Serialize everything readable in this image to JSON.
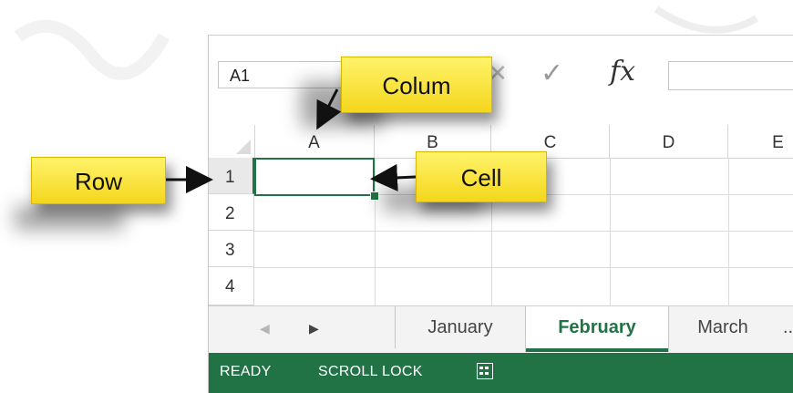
{
  "name_box": {
    "value": "A1"
  },
  "formula_bar": {
    "cancel_icon": "x-icon",
    "enter_icon": "check-icon",
    "fx_label": "fx"
  },
  "columns": [
    "A",
    "B",
    "C",
    "D",
    "E"
  ],
  "rows": [
    "1",
    "2",
    "3",
    "4"
  ],
  "sheet_tabs": {
    "tabs": [
      {
        "label": "January",
        "active": false
      },
      {
        "label": "February",
        "active": true
      },
      {
        "label": "March",
        "active": false
      }
    ],
    "more": "..."
  },
  "status_bar": {
    "ready": "READY",
    "scroll_lock": "SCROLL LOCK",
    "mode_icon": "calculator-icon"
  },
  "callouts": {
    "row": "Row",
    "column": "Colum",
    "cell": "Cell"
  },
  "colors": {
    "excel_green": "#217346",
    "callout_yellow": "#f8e142"
  }
}
